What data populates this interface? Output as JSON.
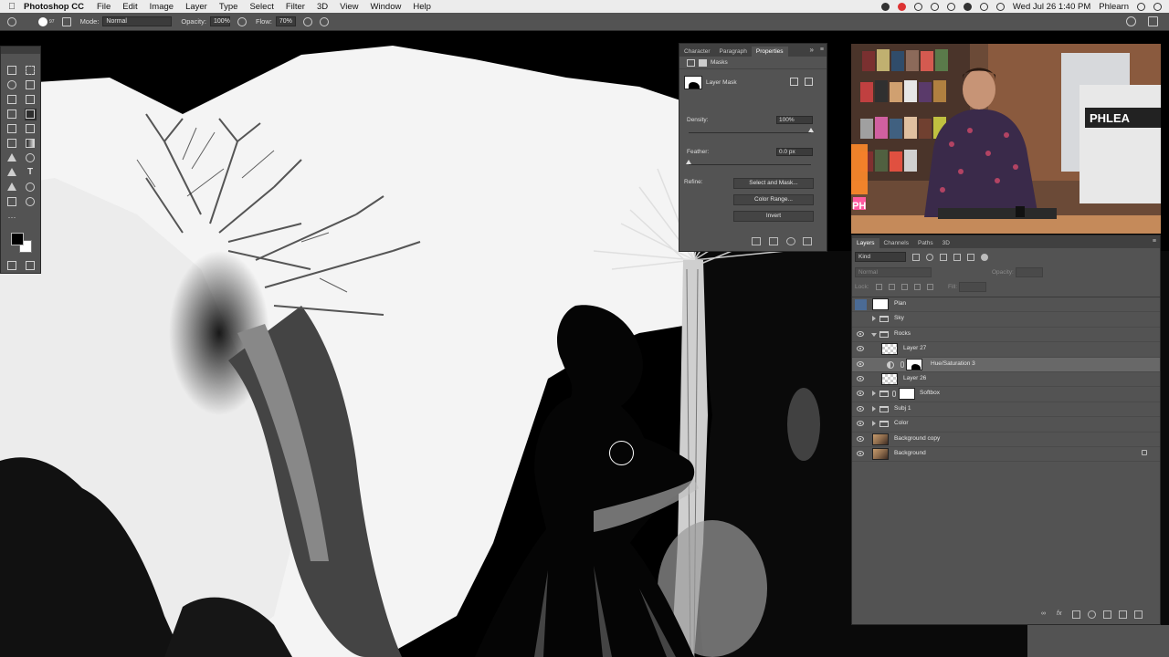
{
  "menubar": {
    "app_name": "Photoshop CC",
    "menus": [
      "File",
      "Edit",
      "Image",
      "Layer",
      "Type",
      "Select",
      "Filter",
      "3D",
      "View",
      "Window",
      "Help"
    ],
    "datetime": "Wed Jul 26  1:40 PM",
    "user": "Phlearn"
  },
  "options": {
    "brush_size": "97",
    "mode_label": "Mode:",
    "mode_value": "Normal",
    "opacity_label": "Opacity:",
    "opacity_value": "100%",
    "flow_label": "Flow:",
    "flow_value": "70%"
  },
  "properties": {
    "tabs": [
      "Character",
      "Paragraph",
      "Properties"
    ],
    "section": "Masks",
    "mask_label": "Layer Mask",
    "density_label": "Density:",
    "density_value": "100%",
    "density_level_pct": 100,
    "feather_label": "Feather:",
    "feather_value": "0.0 px",
    "feather_level_pct": 0,
    "refine_label": "Refine:",
    "buttons": [
      "Select and Mask...",
      "Color Range...",
      "Invert"
    ]
  },
  "layers": {
    "tabs": [
      "Layers",
      "Channels",
      "Paths",
      "3D"
    ],
    "kind_label": "Kind",
    "blend_value": "Normal",
    "opacity_label": "Opacity:",
    "lock_label": "Lock:",
    "fill_label": "Fill:",
    "items": [
      {
        "name": "Plan"
      },
      {
        "name": "Sky"
      },
      {
        "name": "Rocks"
      },
      {
        "name": "Layer 27"
      },
      {
        "name": "Hue/Saturation 3"
      },
      {
        "name": "Layer 26"
      },
      {
        "name": "Softbox"
      },
      {
        "name": "Subj 1"
      },
      {
        "name": "Color"
      },
      {
        "name": "Background copy"
      },
      {
        "name": "Background"
      }
    ]
  },
  "webcam": {
    "logo_text": "PHLEA",
    "logo_text_2": "PH"
  }
}
